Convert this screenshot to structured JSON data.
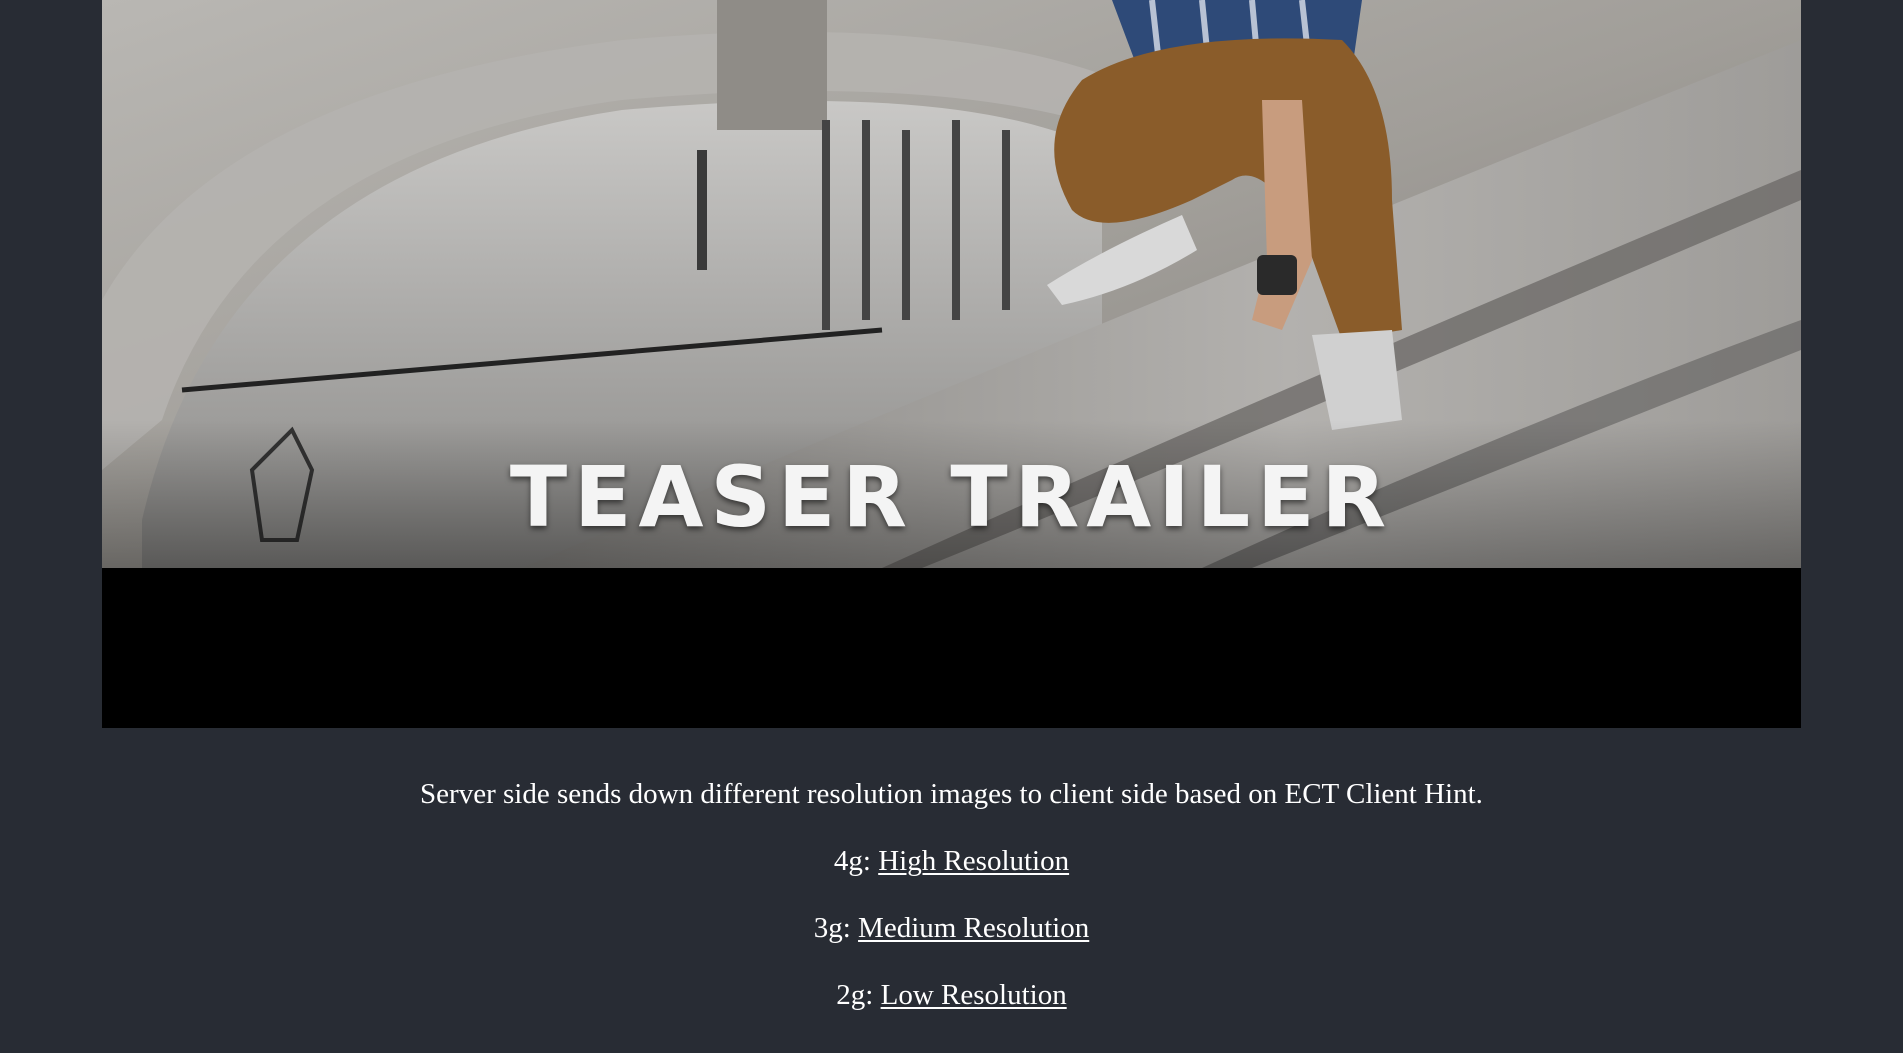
{
  "hero": {
    "caption": "TEASER TRAILER"
  },
  "description": "Server side sends down different resolution images to client side based on ECT Client Hint.",
  "links": [
    {
      "prefix": "4g: ",
      "label": "High Resolution"
    },
    {
      "prefix": "3g: ",
      "label": "Medium Resolution"
    },
    {
      "prefix": "2g: ",
      "label": "Low Resolution"
    }
  ],
  "colors": {
    "page_background": "#282c34",
    "text": "#ffffff",
    "letterbox": "#000000"
  }
}
